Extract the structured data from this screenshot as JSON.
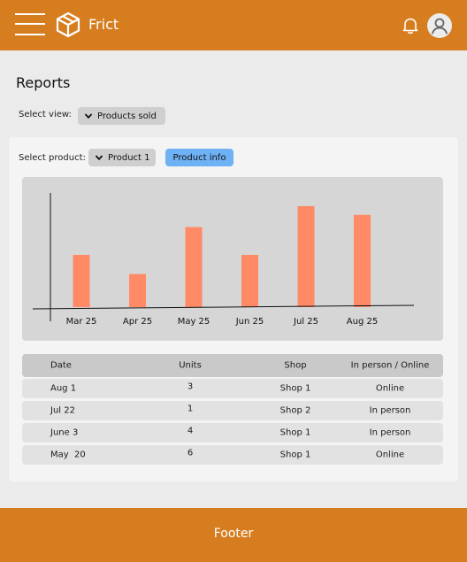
{
  "header": {
    "app_name": "Frict",
    "brand_color": "#d67e1f",
    "icons": [
      "menu-icon",
      "box-logo-icon",
      "bell-icon",
      "user-icon"
    ]
  },
  "page": {
    "title": "Reports",
    "view_label": "Select view:",
    "view_value": "Products sold",
    "product_label": "Select product:",
    "product_value": "Product 1",
    "product_info_label": "Product info",
    "accent_color": "#6fb1f5"
  },
  "chart_data": {
    "type": "bar",
    "categories": [
      "Mar 25",
      "Apr 25",
      "May 25",
      "Jun 25",
      "Jul 25",
      "Aug 25"
    ],
    "values": [
      3,
      1.9,
      4.6,
      3,
      5.8,
      5.3
    ],
    "bar_color": "#ff8a65",
    "ylim": [
      0,
      6
    ],
    "grid": false
  },
  "table": {
    "headers": [
      "Date",
      "Units",
      "Shop",
      "In person / Online"
    ],
    "rows": [
      {
        "date": "Aug 1",
        "units": "3",
        "shop": "Shop 1",
        "mode": "Online"
      },
      {
        "date": "Jul 22",
        "units": "1",
        "shop": "Shop 2",
        "mode": "In person"
      },
      {
        "date": "June 3",
        "units": "4",
        "shop": "Shop 1",
        "mode": "In person"
      },
      {
        "date": "May  20",
        "units": "6",
        "shop": "Shop 1",
        "mode": "Online"
      }
    ]
  },
  "footer": {
    "label": "Footer"
  }
}
